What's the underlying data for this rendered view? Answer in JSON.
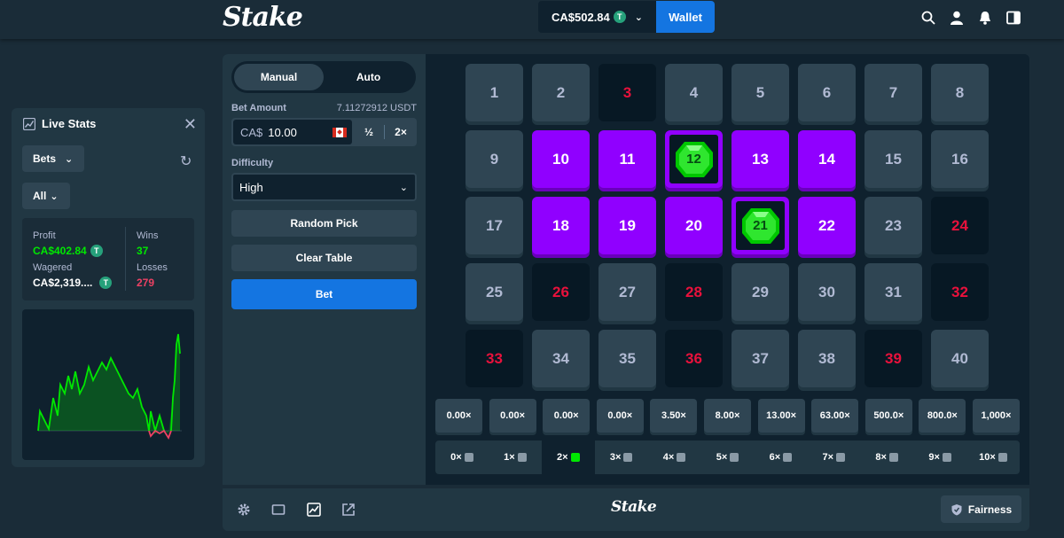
{
  "header": {
    "logo": "Stake",
    "balance": "CA$502.84",
    "wallet_label": "Wallet",
    "icons": [
      "search-icon",
      "user-icon",
      "bell-icon",
      "sidebar-toggle-icon"
    ]
  },
  "live_stats": {
    "title": "Live Stats",
    "filter_bets": "Bets",
    "filter_all": "All",
    "profit_label": "Profit",
    "profit_value": "CA$402.84",
    "wagered_label": "Wagered",
    "wagered_value": "CA$2,319....",
    "wins_label": "Wins",
    "wins_value": "37",
    "losses_label": "Losses",
    "losses_value": "279",
    "colors": {
      "positive": "#00e701",
      "negative": "#ed4163"
    }
  },
  "controls": {
    "tab_manual": "Manual",
    "tab_auto": "Auto",
    "bet_amount_label": "Bet Amount",
    "bet_amount_crypto": "7.11272912 USDT",
    "currency_prefix": "CA$",
    "bet_value": "10.00",
    "half_label": "½",
    "double_label": "2×",
    "difficulty_label": "Difficulty",
    "difficulty_value": "High",
    "random_pick_label": "Random Pick",
    "clear_table_label": "Clear Table",
    "bet_label": "Bet"
  },
  "grid": {
    "tiles": [
      {
        "n": "1",
        "s": "normal"
      },
      {
        "n": "2",
        "s": "normal"
      },
      {
        "n": "3",
        "s": "dark"
      },
      {
        "n": "4",
        "s": "normal"
      },
      {
        "n": "5",
        "s": "normal"
      },
      {
        "n": "6",
        "s": "normal"
      },
      {
        "n": "7",
        "s": "normal"
      },
      {
        "n": "8",
        "s": "normal"
      },
      {
        "n": "9",
        "s": "normal"
      },
      {
        "n": "10",
        "s": "sel"
      },
      {
        "n": "11",
        "s": "sel"
      },
      {
        "n": "12",
        "s": "hit"
      },
      {
        "n": "13",
        "s": "sel"
      },
      {
        "n": "14",
        "s": "sel"
      },
      {
        "n": "15",
        "s": "normal"
      },
      {
        "n": "16",
        "s": "normal"
      },
      {
        "n": "17",
        "s": "normal"
      },
      {
        "n": "18",
        "s": "sel"
      },
      {
        "n": "19",
        "s": "sel"
      },
      {
        "n": "20",
        "s": "sel"
      },
      {
        "n": "21",
        "s": "hit"
      },
      {
        "n": "22",
        "s": "sel"
      },
      {
        "n": "23",
        "s": "normal"
      },
      {
        "n": "24",
        "s": "dark"
      },
      {
        "n": "25",
        "s": "normal"
      },
      {
        "n": "26",
        "s": "dark"
      },
      {
        "n": "27",
        "s": "normal"
      },
      {
        "n": "28",
        "s": "dark"
      },
      {
        "n": "29",
        "s": "normal"
      },
      {
        "n": "30",
        "s": "normal"
      },
      {
        "n": "31",
        "s": "normal"
      },
      {
        "n": "32",
        "s": "dark"
      },
      {
        "n": "33",
        "s": "dark"
      },
      {
        "n": "34",
        "s": "normal"
      },
      {
        "n": "35",
        "s": "normal"
      },
      {
        "n": "36",
        "s": "dark"
      },
      {
        "n": "37",
        "s": "normal"
      },
      {
        "n": "38",
        "s": "normal"
      },
      {
        "n": "39",
        "s": "dark"
      },
      {
        "n": "40",
        "s": "normal"
      }
    ]
  },
  "payouts": [
    "0.00×",
    "0.00×",
    "0.00×",
    "0.00×",
    "3.50×",
    "8.00×",
    "13.00×",
    "63.00×",
    "500.0×",
    "800.0×",
    "1,000×"
  ],
  "hits": [
    {
      "label": "0×",
      "gem": "grey"
    },
    {
      "label": "1×",
      "gem": "grey"
    },
    {
      "label": "2×",
      "gem": "green",
      "active": true
    },
    {
      "label": "3×",
      "gem": "grey"
    },
    {
      "label": "4×",
      "gem": "grey"
    },
    {
      "label": "5×",
      "gem": "grey"
    },
    {
      "label": "6×",
      "gem": "grey"
    },
    {
      "label": "7×",
      "gem": "grey"
    },
    {
      "label": "8×",
      "gem": "grey"
    },
    {
      "label": "9×",
      "gem": "grey"
    },
    {
      "label": "10×",
      "gem": "grey"
    }
  ],
  "footer": {
    "logo": "Stake",
    "fairness_label": "Fairness",
    "icons": [
      "settings-icon",
      "theatre-mode-icon",
      "stats-chart-icon",
      "popout-icon"
    ]
  }
}
